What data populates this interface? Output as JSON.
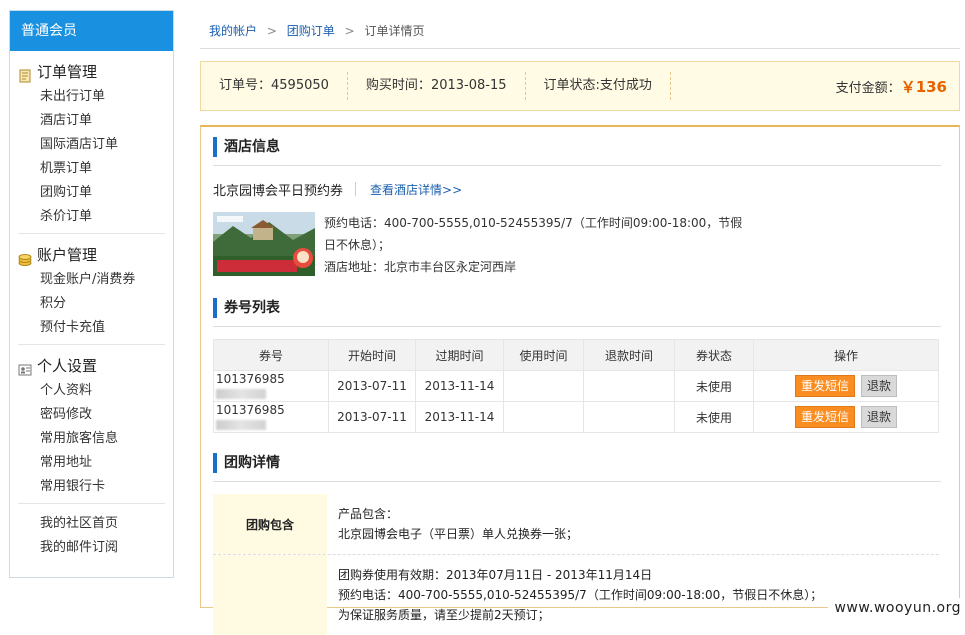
{
  "sidebar": {
    "header": "普通会员",
    "groups": [
      {
        "title": "订单管理",
        "icon": "order-icon",
        "items": [
          "未出行订单",
          "酒店订单",
          "国际酒店订单",
          "机票订单",
          "团购订单",
          "杀价订单"
        ]
      },
      {
        "title": "账户管理",
        "icon": "coins-icon",
        "items": [
          "现金账户/消费券",
          "积分",
          "预付卡充值"
        ]
      },
      {
        "title": "个人设置",
        "icon": "id-card-icon",
        "items": [
          "个人资料",
          "密码修改",
          "常用旅客信息",
          "常用地址",
          "常用银行卡"
        ]
      },
      {
        "title": "",
        "items": [
          "我的社区首页",
          "我的邮件订阅"
        ]
      }
    ]
  },
  "breadcrumb": {
    "items": [
      "我的帐户",
      "团购订单",
      "订单详情页"
    ],
    "separator": ">"
  },
  "order": {
    "number_label": "订单号：",
    "number": "4595050",
    "date_label": "购买时间：",
    "date": "2013-08-15",
    "status_label": "订单状态:",
    "status": "支付成功",
    "amount_label": "支付金额：",
    "currency": "￥",
    "amount": "136"
  },
  "hotel": {
    "section_title": "酒店信息",
    "name": "北京园博会平日预约券",
    "detail_link": "查看酒店详情>>",
    "phone": "预约电话：400-700-5555,010-52455395/7（工作时间09:00-18:00，节假日不休息）；",
    "address": "酒店地址：北京市丰台区永定河西岸",
    "image_caption": "北京园博会平日预约券"
  },
  "vouchers": {
    "section_title": "券号列表",
    "headers": [
      "券号",
      "开始时间",
      "过期时间",
      "使用时间",
      "退款时间",
      "券状态",
      "操作"
    ],
    "rows": [
      {
        "code": "101376985",
        "start": "2013-07-11",
        "end": "2013-11-14",
        "used": "",
        "refund": "",
        "status": "未使用"
      },
      {
        "code": "101376985",
        "start": "2013-07-11",
        "end": "2013-11-14",
        "used": "",
        "refund": "",
        "status": "未使用"
      }
    ],
    "resend_label": "重发短信",
    "refund_label": "退款"
  },
  "group_detail": {
    "section_title": "团购详情",
    "rows": [
      {
        "label": "团购包含",
        "lines": [
          "产品包含：",
          "北京园博会电子（平日票）单人兑换券一张；"
        ]
      },
      {
        "label": "",
        "lines": [
          "团购券使用有效期：2013年07月11日 - 2013年11月14日",
          "预约电话：400-700-5555,010-52455395/7（工作时间09:00-18:00，节假日不休息）；",
          "为保证服务质量，请至少提前2天预订；"
        ]
      }
    ]
  },
  "watermark": "www.wooyun.org",
  "colors": {
    "accent": "#1a90e0",
    "orange": "#f98d22",
    "price": "#e76300"
  }
}
